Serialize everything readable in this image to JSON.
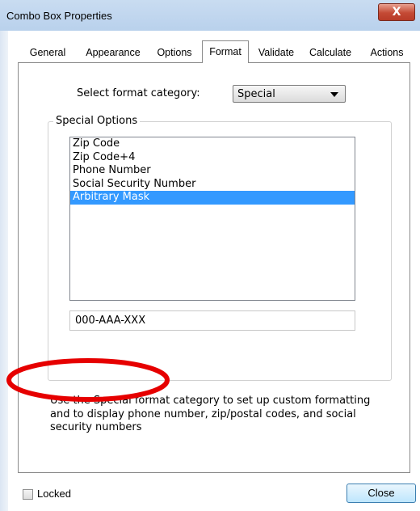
{
  "window": {
    "title": "Combo Box Properties",
    "close_glyph": "X"
  },
  "tabs": [
    {
      "label": "General"
    },
    {
      "label": "Appearance"
    },
    {
      "label": "Options"
    },
    {
      "label": "Format",
      "active": true
    },
    {
      "label": "Validate"
    },
    {
      "label": "Calculate"
    },
    {
      "label": "Actions"
    }
  ],
  "format": {
    "category_label": "Select format category:",
    "category_value": "Special"
  },
  "special_options": {
    "group_label": "Special Options",
    "items": [
      {
        "label": "Zip Code"
      },
      {
        "label": "Zip Code+4"
      },
      {
        "label": "Phone Number"
      },
      {
        "label": "Social Security Number"
      },
      {
        "label": "Arbitrary Mask",
        "selected": true
      }
    ],
    "mask_value": "000-AAA-XXX"
  },
  "description": "Use the Special format category to set up custom formatting and to display phone number, zip/postal codes, and social security numbers",
  "footer": {
    "locked_label": "Locked",
    "locked_checked": false,
    "close_label": "Close"
  },
  "colors": {
    "selection": "#3399ff",
    "annotation": "#e60000"
  }
}
